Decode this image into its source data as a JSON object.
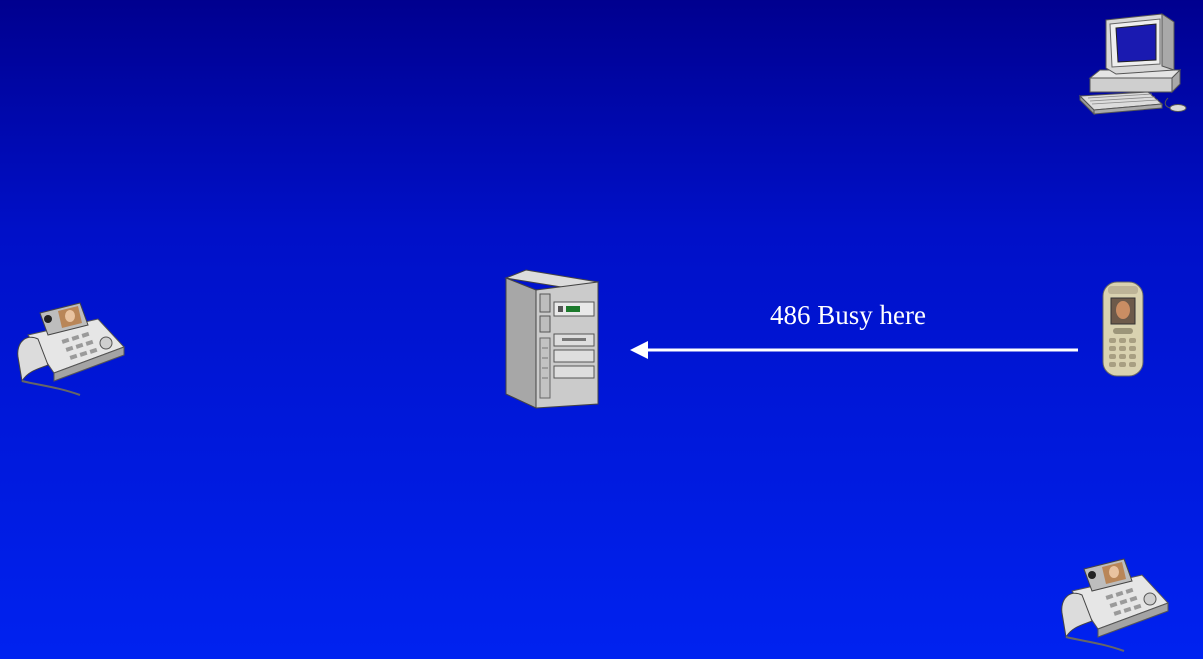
{
  "nodes": {
    "desktop": {
      "icon": "desktop-computer-icon"
    },
    "server": {
      "icon": "server-tower-icon"
    },
    "phone_left": {
      "icon": "video-desk-phone-icon"
    },
    "phone_bottom": {
      "icon": "video-desk-phone-icon"
    },
    "mobile": {
      "icon": "mobile-phone-icon"
    }
  },
  "message": {
    "label": "486 Busy here",
    "from": "mobile",
    "to": "server",
    "direction": "right-to-left"
  },
  "colors": {
    "background_top": "#00008f",
    "background_bottom": "#0022f0",
    "text": "#ffffff",
    "arrow": "#ffffff"
  }
}
